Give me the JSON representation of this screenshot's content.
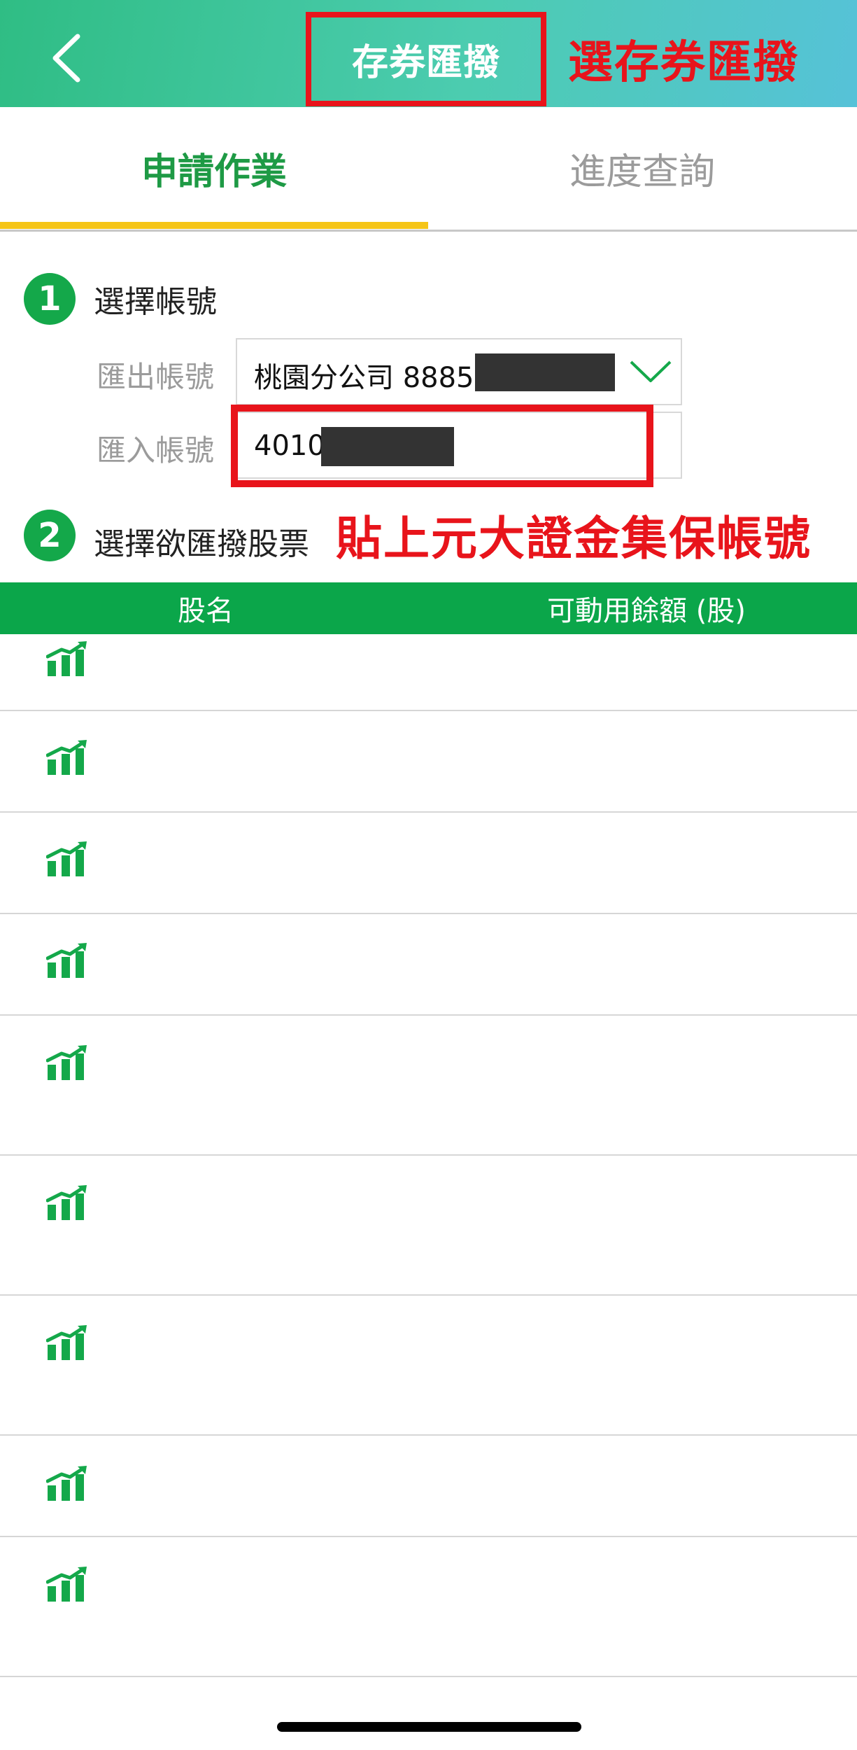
{
  "header": {
    "back_icon": "chevron-left-icon",
    "title": "存券匯撥",
    "annotation": "選存券匯撥",
    "annotation_color": "#e8141b"
  },
  "tabs": [
    {
      "label": "申請作業",
      "active": true
    },
    {
      "label": "進度查詢",
      "active": false
    }
  ],
  "step1": {
    "number": "1",
    "title": "選擇帳號",
    "out_label": "匯出帳號",
    "out_value": "桃園分公司 8885",
    "in_label": "匯入帳號",
    "in_value": "4010"
  },
  "step2": {
    "number": "2",
    "title": "選擇欲匯撥股票",
    "annotation": "貼上元大證金集保帳號"
  },
  "table": {
    "columns": [
      "股名",
      "可動用餘額 (股)"
    ],
    "row_icon": "stock-chart-icon",
    "rows": 9
  },
  "colors": {
    "accent_green": "#14a84a",
    "tab_active": "#1e9a45",
    "tab_underline": "#f5c518",
    "annotation_red": "#e8141b"
  }
}
